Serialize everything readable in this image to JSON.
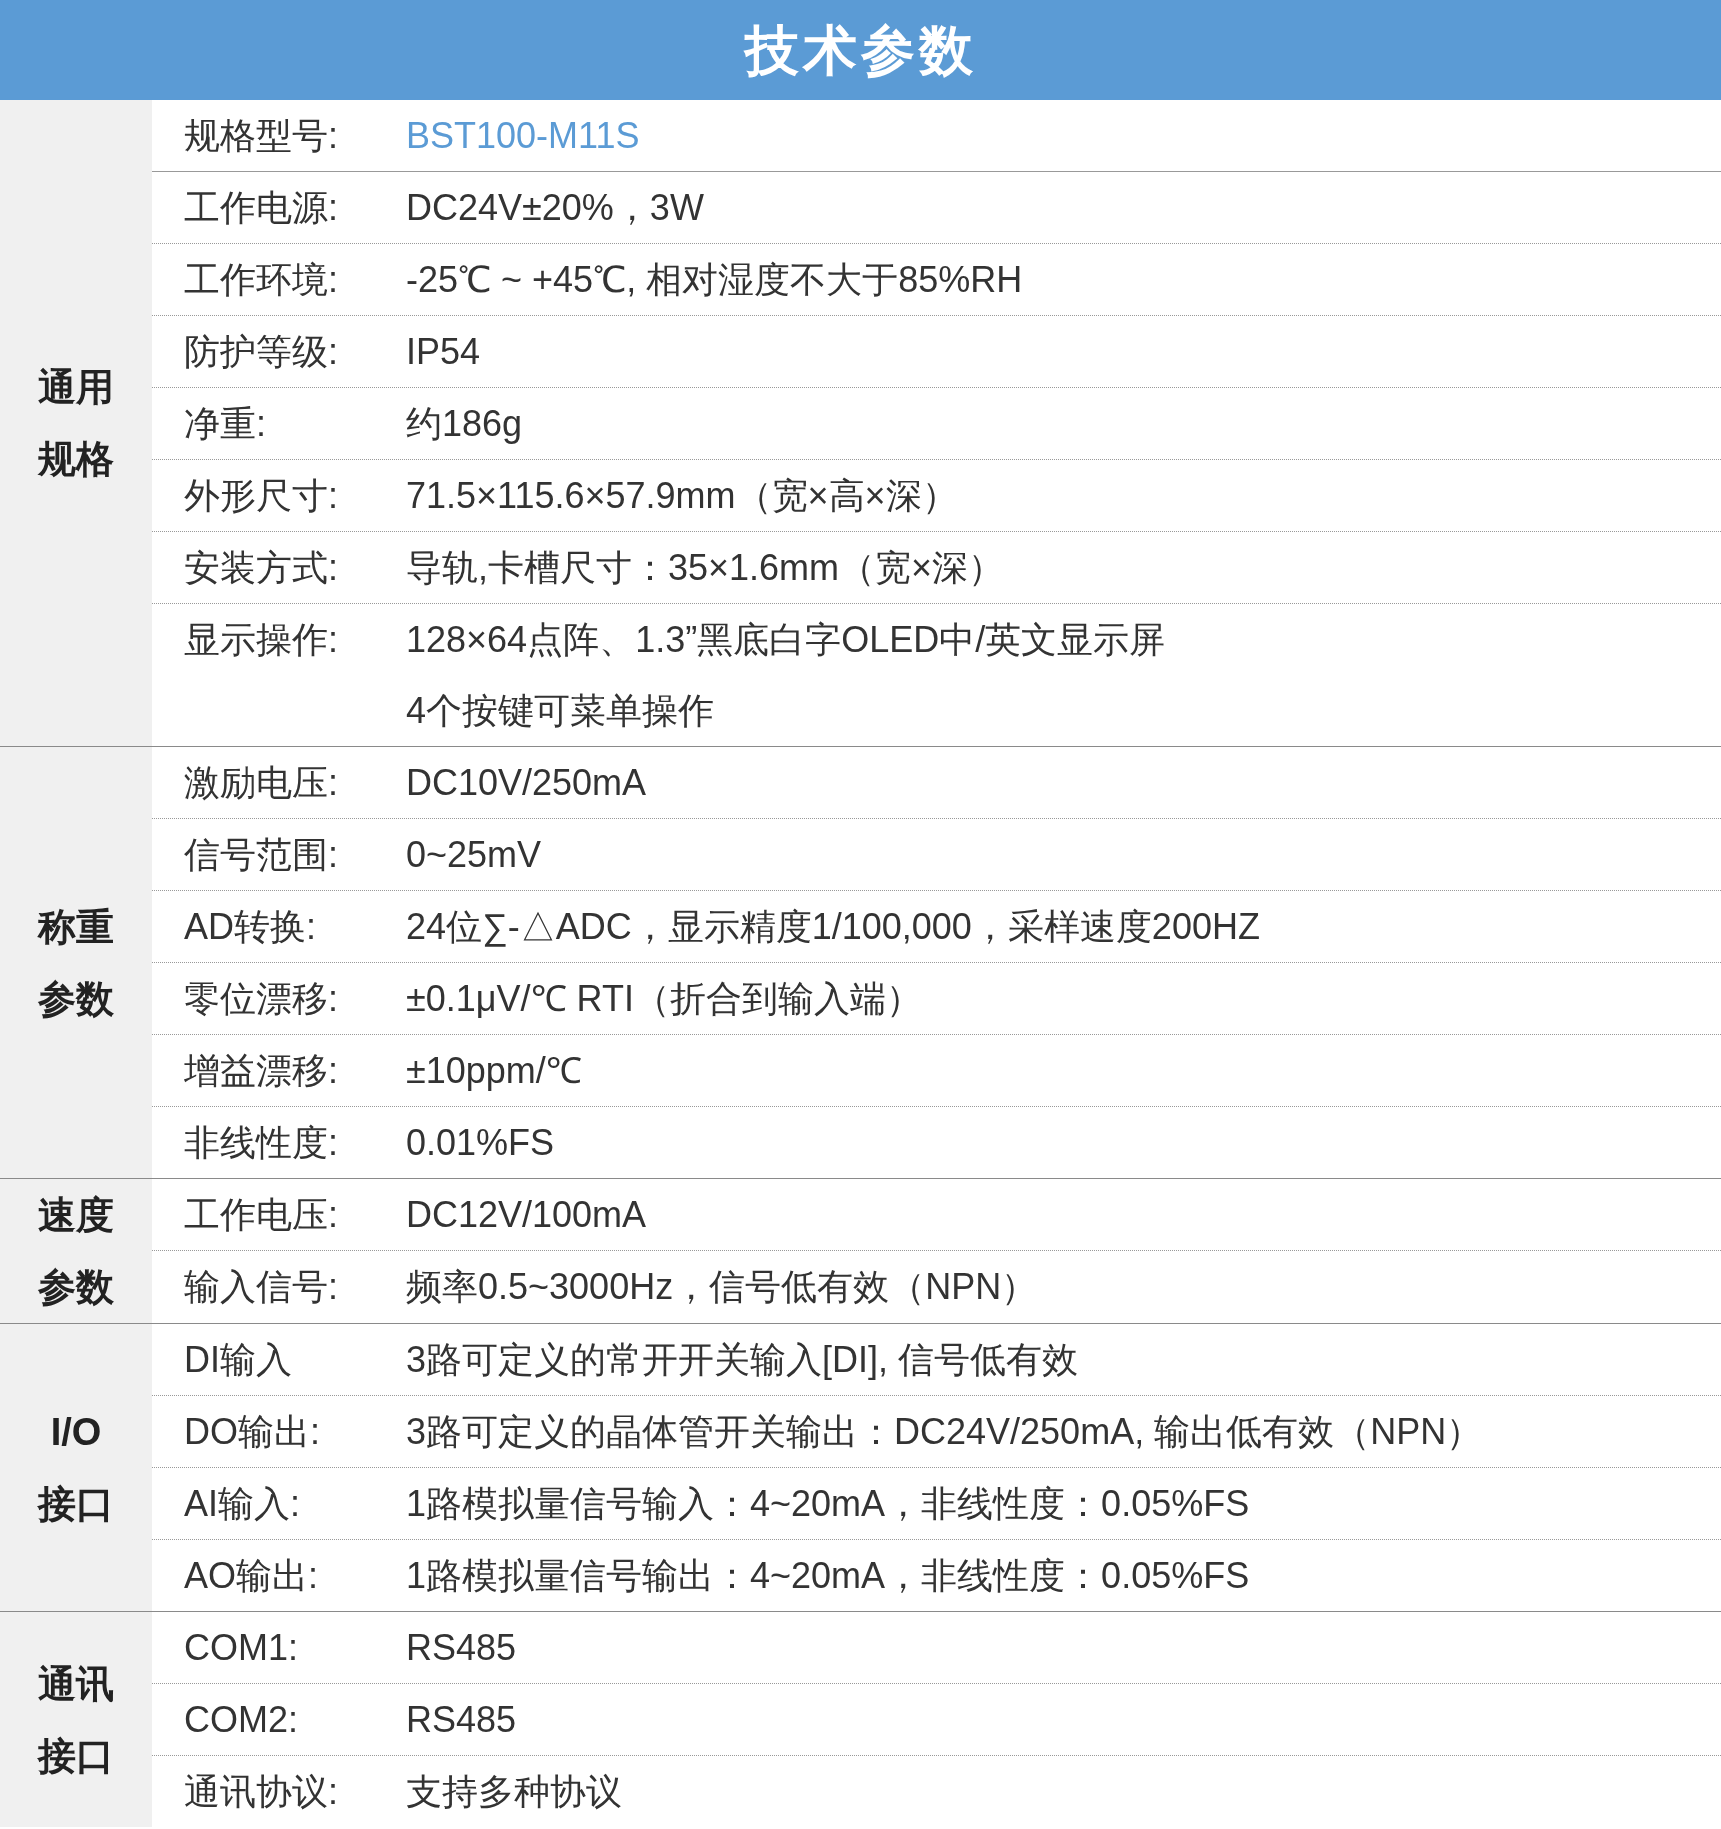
{
  "title": "技术参数",
  "groups": [
    {
      "label_lines": [
        "通用",
        "规格"
      ],
      "rows": [
        {
          "label": "规格型号:",
          "values": [
            "BST100-M11S"
          ],
          "highlighted": true
        },
        {
          "label": "工作电源:",
          "values": [
            "DC24V±20%，3W"
          ],
          "highlighted": false
        },
        {
          "label": "工作环境:",
          "values": [
            "-25℃ ~ +45℃, 相对湿度不大于85%RH"
          ],
          "highlighted": false
        },
        {
          "label": "防护等级:",
          "values": [
            "IP54"
          ],
          "highlighted": false
        },
        {
          "label": "净重:",
          "values": [
            "约186g"
          ],
          "highlighted": false
        },
        {
          "label": "外形尺寸:",
          "values": [
            "71.5×115.6×57.9mm（宽×高×深）"
          ],
          "highlighted": false
        },
        {
          "label": "安装方式:",
          "values": [
            "导轨,卡槽尺寸：35×1.6mm（宽×深）"
          ],
          "highlighted": false
        },
        {
          "label": "显示操作:",
          "values": [
            "128×64点阵、1.3”黑底白字OLED中/英文显示屏",
            "4个按键可菜单操作"
          ],
          "highlighted": false
        }
      ]
    },
    {
      "label_lines": [
        "称重",
        "参数"
      ],
      "rows": [
        {
          "label": "激励电压:",
          "values": [
            "DC10V/250mA"
          ],
          "highlighted": false
        },
        {
          "label": "信号范围:",
          "values": [
            "0~25mV"
          ],
          "highlighted": false
        },
        {
          "label": "AD转换:",
          "values": [
            "24位∑-△ADC，显示精度1/100,000，采样速度200HZ"
          ],
          "highlighted": false
        },
        {
          "label": "零位漂移:",
          "values": [
            "±0.1μV/℃ RTI（折合到输入端）"
          ],
          "highlighted": false
        },
        {
          "label": "增益漂移:",
          "values": [
            "±10ppm/℃"
          ],
          "highlighted": false
        },
        {
          "label": "非线性度:",
          "values": [
            "0.01%FS"
          ],
          "highlighted": false
        }
      ]
    },
    {
      "label_lines": [
        "速度",
        "参数"
      ],
      "rows": [
        {
          "label": "工作电压:",
          "values": [
            "DC12V/100mA"
          ],
          "highlighted": false
        },
        {
          "label": "输入信号:",
          "values": [
            "频率0.5~3000Hz，信号低有效（NPN）"
          ],
          "highlighted": false
        }
      ]
    },
    {
      "label_lines": [
        "I/O",
        "接口"
      ],
      "rows": [
        {
          "label": "DI输入",
          "values": [
            "3路可定义的常开开关输入[DI], 信号低有效"
          ],
          "highlighted": false
        },
        {
          "label": "DO输出:",
          "values": [
            "3路可定义的晶体管开关输出：DC24V/250mA, 输出低有效（NPN）"
          ],
          "highlighted": false
        },
        {
          "label": "AI输入:",
          "values": [
            "1路模拟量信号输入：4~20mA，非线性度：0.05%FS"
          ],
          "highlighted": false
        },
        {
          "label": "AO输出:",
          "values": [
            "1路模拟量信号输出：4~20mA，非线性度：0.05%FS"
          ],
          "highlighted": false
        }
      ]
    },
    {
      "label_lines": [
        "通讯",
        "接口"
      ],
      "rows": [
        {
          "label": "COM1:",
          "values": [
            "RS485"
          ],
          "highlighted": false
        },
        {
          "label": "COM2:",
          "values": [
            "RS485"
          ],
          "highlighted": false
        },
        {
          "label": "通讯协议:",
          "values": [
            "支持多种协议"
          ],
          "highlighted": false
        }
      ]
    }
  ]
}
